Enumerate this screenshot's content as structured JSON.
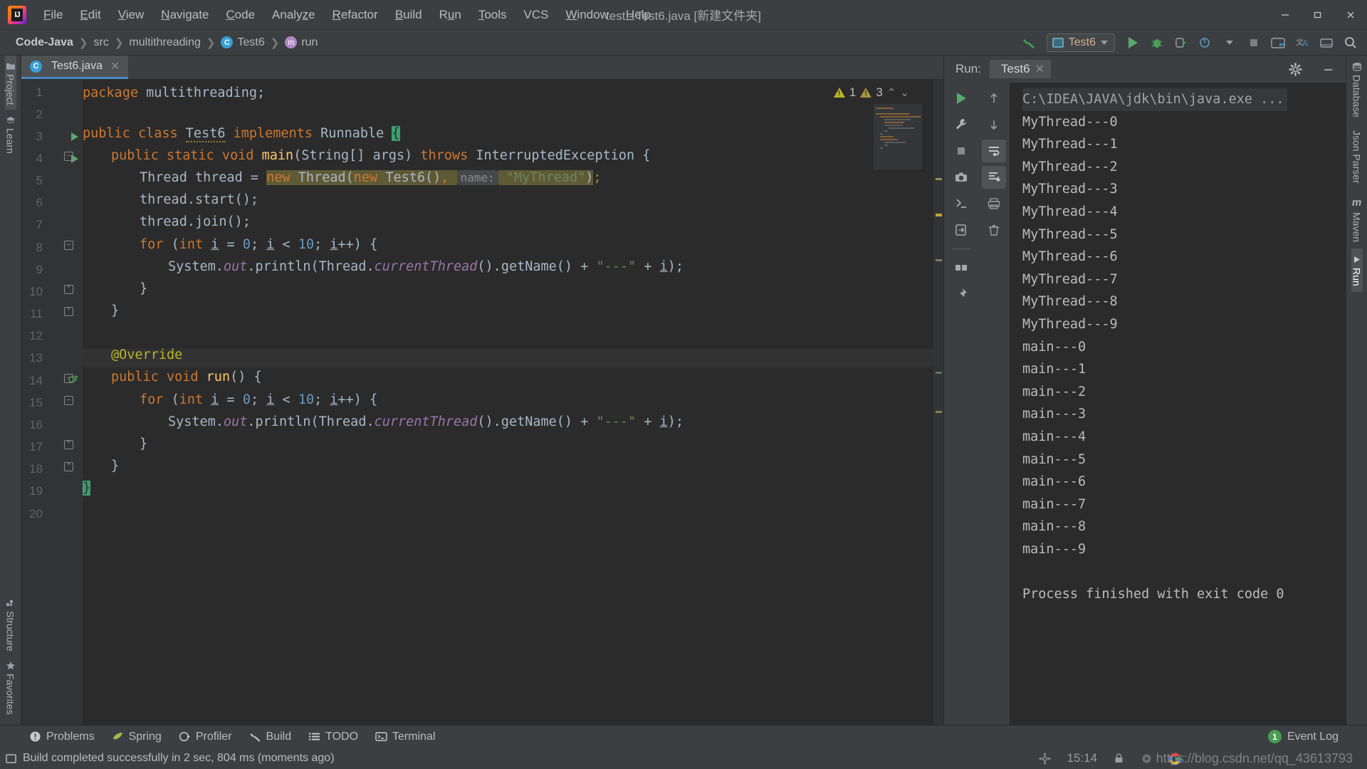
{
  "window": {
    "title": "test - Test6.java [新建文件夹]",
    "app_icon": "intellij-idea-logo",
    "minimize": "—",
    "maximize": "❐",
    "close": "✕"
  },
  "menu": [
    {
      "label": "File",
      "mnemonic": "F"
    },
    {
      "label": "Edit",
      "mnemonic": "E"
    },
    {
      "label": "View",
      "mnemonic": "V"
    },
    {
      "label": "Navigate",
      "mnemonic": "N"
    },
    {
      "label": "Code",
      "mnemonic": "C"
    },
    {
      "label": "Analyze",
      "mnemonic": "z"
    },
    {
      "label": "Refactor",
      "mnemonic": "R"
    },
    {
      "label": "Build",
      "mnemonic": "B"
    },
    {
      "label": "Run",
      "mnemonic": "u"
    },
    {
      "label": "Tools",
      "mnemonic": "T"
    },
    {
      "label": "VCS",
      "mnemonic": ""
    },
    {
      "label": "Window",
      "mnemonic": "W"
    },
    {
      "label": "Help",
      "mnemonic": "H"
    }
  ],
  "navbar": {
    "breadcrumbs": [
      {
        "label": "Code-Java",
        "icon": ""
      },
      {
        "label": "src",
        "icon": ""
      },
      {
        "label": "multithreading",
        "icon": ""
      },
      {
        "label": "Test6",
        "icon": "class-icon"
      },
      {
        "label": "run",
        "icon": "method-icon"
      }
    ],
    "separator": "❯",
    "run_config": "Test6",
    "toolbar_icons": [
      "build-hammer-icon",
      "run-icon",
      "debug-icon",
      "run-coverage-icon",
      "profile-icon",
      "stop-icon",
      "project-structure-icon",
      "translate-icon",
      "layout-icon",
      "search-everywhere-icon"
    ]
  },
  "left_strip": [
    {
      "label": "Project",
      "icon": "folder-icon",
      "active": true
    },
    {
      "label": "Learn",
      "icon": "graduation-cap-icon",
      "active": false
    },
    {
      "label": "Structure",
      "icon": "structure-icon",
      "active": false
    },
    {
      "label": "Favorites",
      "icon": "star-icon",
      "active": false
    }
  ],
  "right_strip": [
    {
      "label": "Database",
      "icon": "database-icon",
      "active": false
    },
    {
      "label": "Json Parser",
      "icon": "",
      "active": false
    },
    {
      "label": "Maven",
      "icon": "maven-m-icon",
      "active": false
    },
    {
      "label": "Run",
      "icon": "play-icon",
      "active": true
    }
  ],
  "editor": {
    "tab": {
      "label": "Test6.java",
      "icon": "java-class-icon",
      "close": "✕"
    },
    "inspection": {
      "error_count": "1",
      "warning_count": "3",
      "up": "⌃",
      "down": "⌄"
    },
    "line_count": 20,
    "lines": [
      {
        "n": 1,
        "indent": 0
      },
      {
        "n": 2,
        "indent": 0
      },
      {
        "n": 3,
        "indent": 0,
        "runmarker": true
      },
      {
        "n": 4,
        "indent": 1,
        "runmarker": true,
        "fold": true
      },
      {
        "n": 5,
        "indent": 2
      },
      {
        "n": 6,
        "indent": 2
      },
      {
        "n": 7,
        "indent": 2
      },
      {
        "n": 8,
        "indent": 2,
        "fold": true
      },
      {
        "n": 9,
        "indent": 3
      },
      {
        "n": 10,
        "indent": 2,
        "fold": true
      },
      {
        "n": 11,
        "indent": 1,
        "fold": true
      },
      {
        "n": 12,
        "indent": 0
      },
      {
        "n": 13,
        "indent": 1,
        "highlight": true
      },
      {
        "n": 14,
        "indent": 1,
        "override": true,
        "fold": true
      },
      {
        "n": 15,
        "indent": 2,
        "fold": true
      },
      {
        "n": 16,
        "indent": 3
      },
      {
        "n": 17,
        "indent": 2,
        "fold": true
      },
      {
        "n": 18,
        "indent": 1,
        "fold": true
      },
      {
        "n": 19,
        "indent": 0,
        "caret": true
      },
      {
        "n": 20,
        "indent": 0
      }
    ],
    "code_text": [
      "package multithreading;",
      "",
      "public class Test6 implements Runnable {",
      "    public static void main(String[] args) throws InterruptedException {",
      "        Thread thread = new Thread(new Test6(),  name: \"MyThread\");",
      "        thread.start();",
      "        thread.join();",
      "        for (int i = 0; i < 10; i++) {",
      "            System.out.println(Thread.currentThread().getName() + \"---\" + i);",
      "        }",
      "    }",
      "",
      "    @Override",
      "    public void run() {",
      "        for (int i = 0; i < 10; i++) {",
      "            System.out.println(Thread.currentThread().getName() + \"---\" + i);",
      "        }",
      "    }",
      "}",
      ""
    ],
    "param_hint": "name:"
  },
  "run_window": {
    "label": "Run:",
    "tab": "Test6",
    "tab_close": "✕",
    "settings_icon": "gear-icon",
    "minimize_icon": "minimize-icon",
    "left_tools": [
      "rerun-icon",
      "wrench-icon",
      "stop-icon",
      "camera-icon",
      "thread-dump-icon",
      "export-icon",
      "layout-icon",
      "pin-icon"
    ],
    "right_tools": [
      "up-arrow-icon",
      "down-arrow-icon",
      "soft-wrap-icon",
      "scroll-to-end-icon",
      "print-icon",
      "trash-icon"
    ],
    "console": [
      {
        "text": "C:\\IDEA\\JAVA\\jdk\\bin\\java.exe ...",
        "type": "path"
      },
      {
        "text": "MyThread---0",
        "type": "out"
      },
      {
        "text": "MyThread---1",
        "type": "out"
      },
      {
        "text": "MyThread---2",
        "type": "out"
      },
      {
        "text": "MyThread---3",
        "type": "out"
      },
      {
        "text": "MyThread---4",
        "type": "out"
      },
      {
        "text": "MyThread---5",
        "type": "out"
      },
      {
        "text": "MyThread---6",
        "type": "out"
      },
      {
        "text": "MyThread---7",
        "type": "out"
      },
      {
        "text": "MyThread---8",
        "type": "out"
      },
      {
        "text": "MyThread---9",
        "type": "out"
      },
      {
        "text": "main---0",
        "type": "out"
      },
      {
        "text": "main---1",
        "type": "out"
      },
      {
        "text": "main---2",
        "type": "out"
      },
      {
        "text": "main---3",
        "type": "out"
      },
      {
        "text": "main---4",
        "type": "out"
      },
      {
        "text": "main---5",
        "type": "out"
      },
      {
        "text": "main---6",
        "type": "out"
      },
      {
        "text": "main---7",
        "type": "out"
      },
      {
        "text": "main---8",
        "type": "out"
      },
      {
        "text": "main---9",
        "type": "out"
      },
      {
        "text": "",
        "type": "out"
      },
      {
        "text": "Process finished with exit code 0",
        "type": "out"
      }
    ]
  },
  "bottom_bar": {
    "buttons": [
      {
        "label": "Problems",
        "icon": "problems-icon"
      },
      {
        "label": "Spring",
        "icon": "spring-leaf-icon"
      },
      {
        "label": "Profiler",
        "icon": "profiler-icon"
      },
      {
        "label": "Build",
        "icon": "build-hammer-icon"
      },
      {
        "label": "TODO",
        "icon": "todo-list-icon"
      },
      {
        "label": "Terminal",
        "icon": "terminal-icon"
      }
    ],
    "event_log": {
      "label": "Event Log",
      "count": "1"
    }
  },
  "status_bar": {
    "message": "Build completed successfully in 2 sec, 804 ms (moments ago)",
    "icon": "memory-icon",
    "watermark": "https://blog.csdn.net/qq_43613793"
  },
  "colors": {
    "accent_blue": "#4a88c7",
    "green_run": "#59a869",
    "orange_keyword": "#cc7832",
    "string_green": "#6a8759",
    "number_blue": "#6897bb",
    "annotation": "#bbb529",
    "bg_editor": "#2b2b2b",
    "bg_chrome": "#3c3f41"
  }
}
